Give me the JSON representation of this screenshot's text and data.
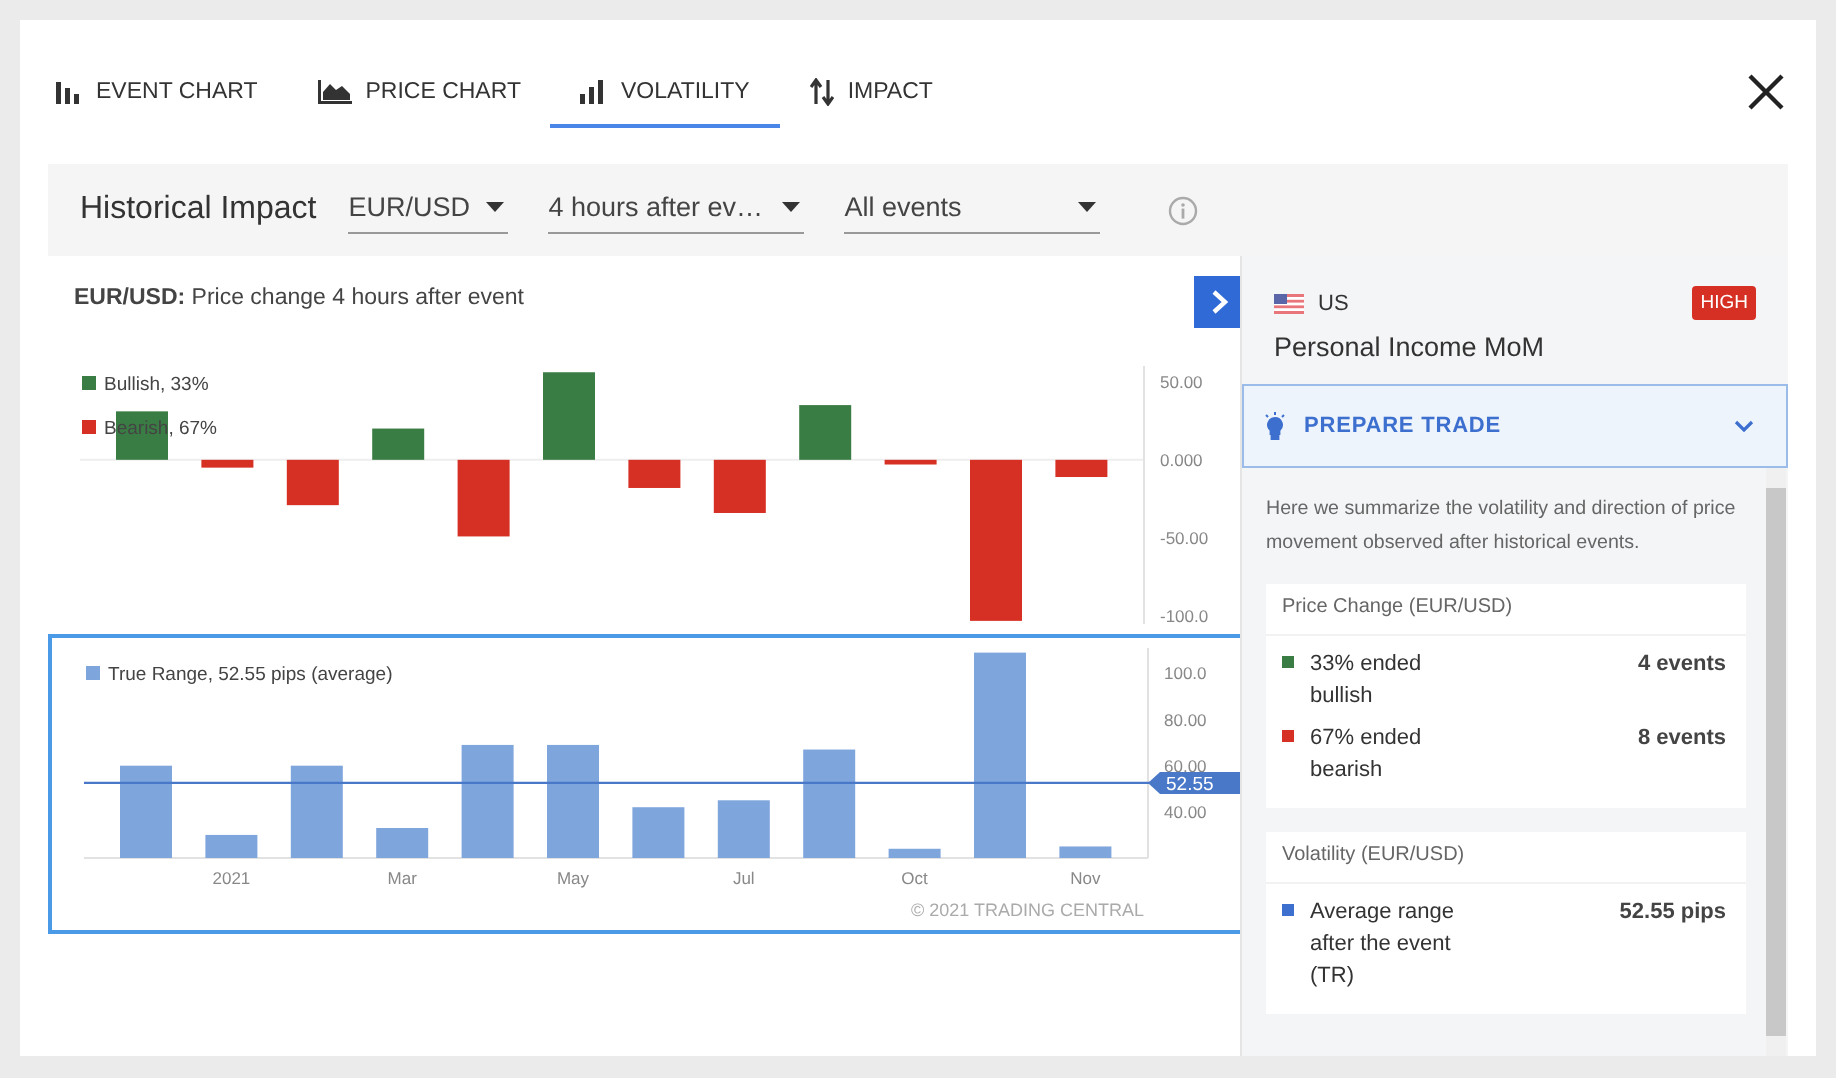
{
  "tabs": [
    {
      "label": "EVENT CHART",
      "selected": false
    },
    {
      "label": "PRICE CHART",
      "selected": false
    },
    {
      "label": "VOLATILITY",
      "selected": true
    },
    {
      "label": "IMPACT",
      "selected": false
    }
  ],
  "toolbar": {
    "title": "Historical Impact",
    "dropdowns": [
      {
        "value": "EUR/USD"
      },
      {
        "value": "4 hours after ev…"
      },
      {
        "value": "All events"
      }
    ]
  },
  "chart_panel": {
    "title": "**EUR/USD:** Price change 4 hours after event",
    "price_chart": {
      "chart_data": {
        "type": "bar",
        "legend": "upper left",
        "ylim": [
          -105,
          60
        ],
        "yticks": [
          {
            "value": 50,
            "label": "50.00"
          },
          {
            "value": 0,
            "label": "0.000"
          },
          {
            "value": -50,
            "label": "-50.00"
          },
          {
            "value": -100,
            "label": "-100.0"
          }
        ],
        "series": [
          {
            "name": "Bullish, 33%",
            "color": "#3a7d44",
            "values": [
              31,
              null,
              null,
              20,
              null,
              56,
              null,
              null,
              35,
              null,
              null,
              null
            ]
          },
          {
            "name": "Bearish, 67%",
            "color": "#d62f24",
            "values": [
              null,
              -5,
              -29,
              null,
              -49,
              null,
              -18,
              -34,
              null,
              -3,
              -103,
              -11
            ]
          }
        ]
      }
    },
    "volatility_chart": {
      "chart_data": {
        "type": "bar",
        "legend": "upper left",
        "ylim": [
          20,
          111
        ],
        "yticks": [
          {
            "value": 100,
            "label": "100.0"
          },
          {
            "value": 80,
            "label": "80.00"
          },
          {
            "value": 60,
            "label": "60.00"
          },
          {
            "value": 40,
            "label": "40.00"
          }
        ],
        "categories": [
          null,
          "2021",
          null,
          "Mar",
          null,
          "May",
          null,
          "Jul",
          null,
          "Oct",
          null,
          "Nov"
        ],
        "series": [
          {
            "name": "True Range, 52.55 pips (average)",
            "color": "#7ea5dc",
            "values": [
              60,
              30,
              60,
              33,
              69,
              69,
              42,
              45,
              67,
              24,
              109,
              25
            ]
          }
        ],
        "ref_lines": [
          {
            "axis": "y",
            "value": 52.55,
            "label": "52.55"
          }
        ]
      },
      "credit": "© 2021 TRADING CENTRAL"
    }
  },
  "event": {
    "country": "US",
    "impact": "HIGH",
    "title": "Personal Income MoM"
  },
  "prepare_trade": {
    "label": "PREPARE TRADE"
  },
  "summary": "Here we summarize the volatility and direction of price movement observed after historical events.",
  "sections": [
    {
      "title": "Price Change (EUR/USD)",
      "rows": [
        {
          "label": "33% ended bullish",
          "value": "4 events",
          "color": "#3a7d44"
        },
        {
          "label": "67% ended bearish",
          "value": "8 events",
          "color": "#d62f24"
        }
      ]
    },
    {
      "title": "Volatility (EUR/USD)",
      "rows": [
        {
          "label": "Average range after the event (TR)",
          "value": "52.55 pips",
          "color": "#3d6fcf"
        }
      ]
    }
  ]
}
